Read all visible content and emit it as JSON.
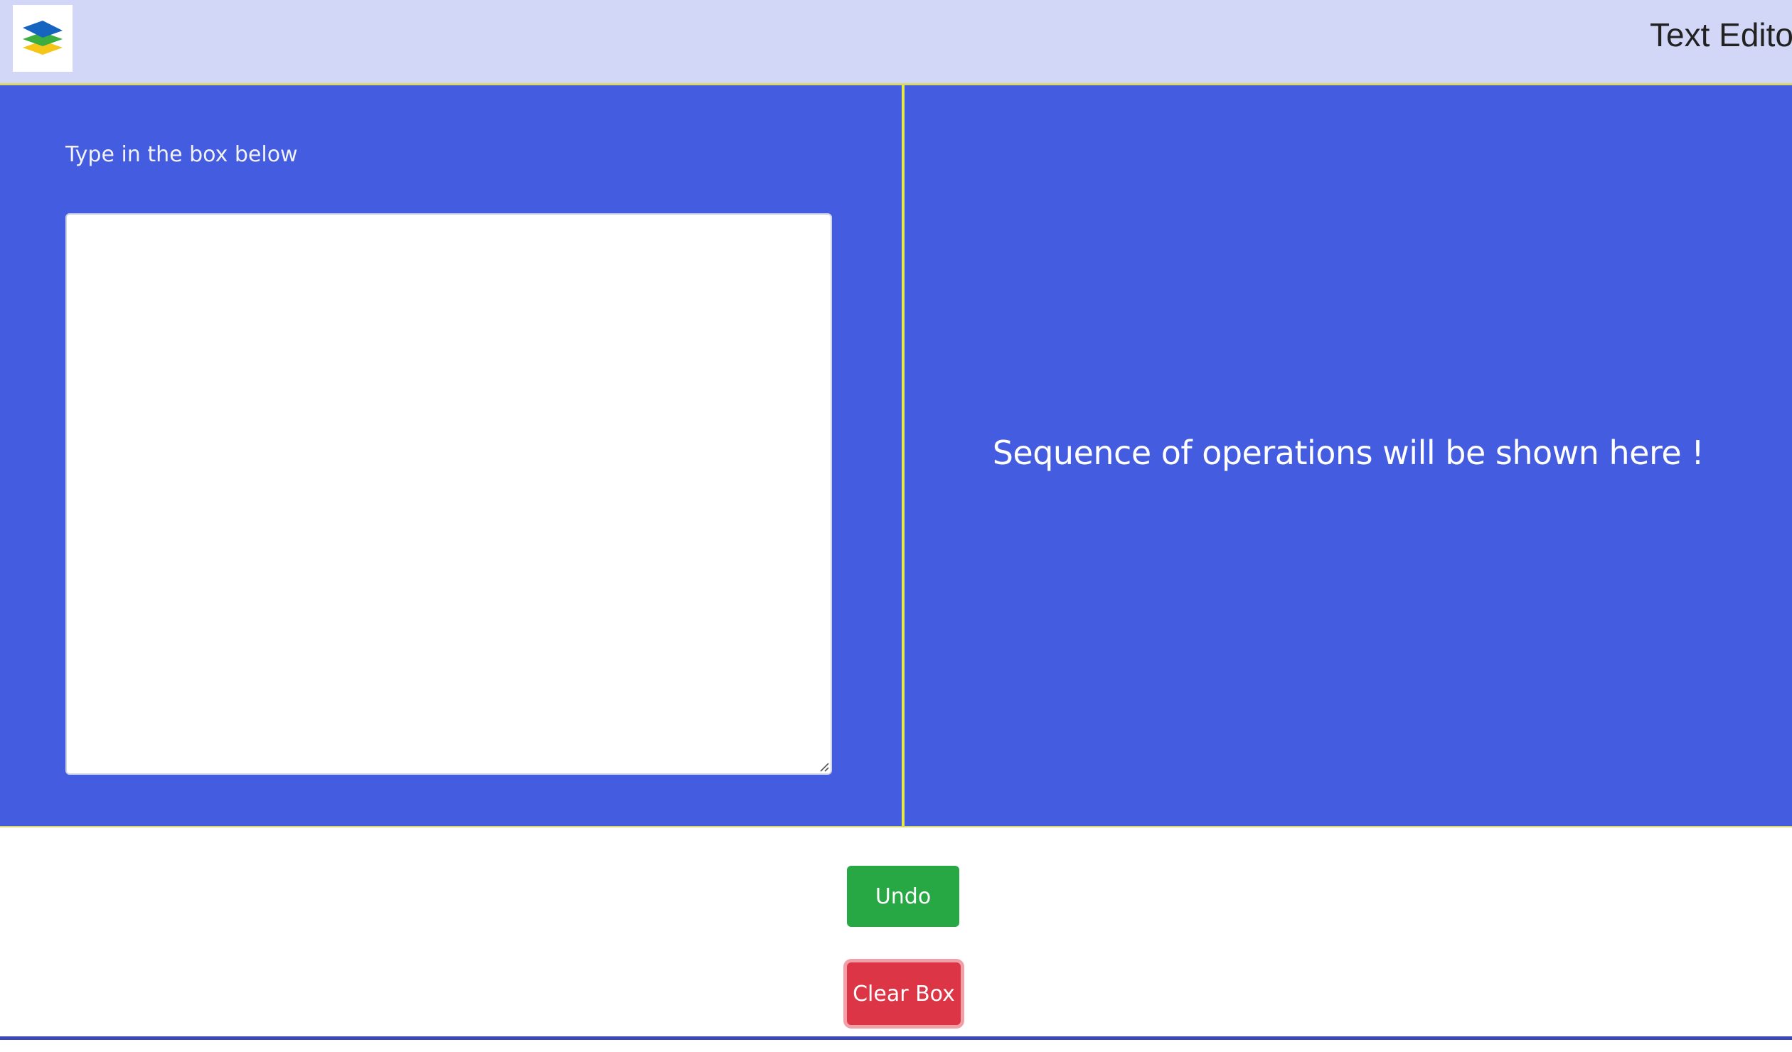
{
  "header": {
    "title": "Text Editor",
    "logo_icon": "layers-stack-icon",
    "background": "#d2d7f7"
  },
  "editor": {
    "label": "Type in the box below",
    "value": "",
    "placeholder": "",
    "background": "#445ce0"
  },
  "operations": {
    "message": "Sequence of operations will be shown here !"
  },
  "actions": {
    "undo_label": "Undo",
    "undo_color": "#28a745",
    "clear_label": "Clear Box",
    "clear_color": "#dc3545"
  }
}
